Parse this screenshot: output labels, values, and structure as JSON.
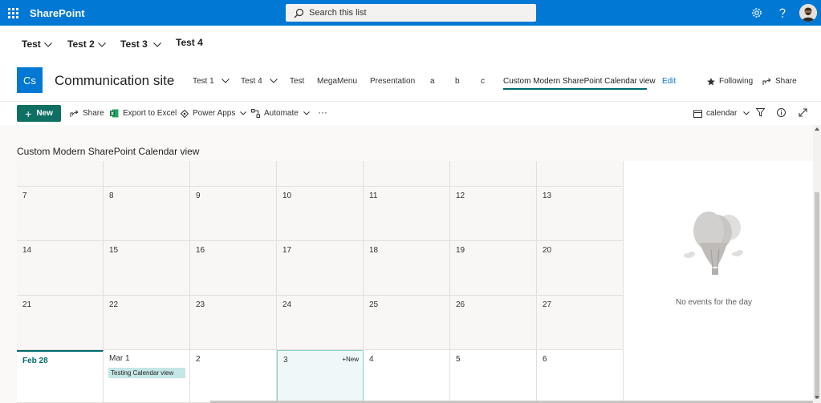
{
  "suitebar": {
    "brand": "SharePoint",
    "search_placeholder": "Search this list"
  },
  "hubnav": {
    "items": [
      {
        "label": "Test",
        "has_dropdown": true
      },
      {
        "label": "Test 2",
        "has_dropdown": true
      },
      {
        "label": "Test 3",
        "has_dropdown": true
      },
      {
        "label": "Test 4",
        "has_dropdown": false
      }
    ]
  },
  "site": {
    "logo_text": "Cs",
    "title": "Communication site",
    "nav": [
      {
        "label": "Test 1",
        "has_dropdown": true
      },
      {
        "label": "Test 4",
        "has_dropdown": true
      },
      {
        "label": "Test"
      },
      {
        "label": "MegaMenu"
      },
      {
        "label": "Presentation"
      },
      {
        "label": "a"
      },
      {
        "label": "b"
      },
      {
        "label": "c"
      },
      {
        "label": "Custom Modern SharePoint Calendar view",
        "active": true
      }
    ],
    "edit_label": "Edit",
    "following_label": "Following",
    "share_label": "Share"
  },
  "commandbar": {
    "new_label": "New",
    "share_label": "Share",
    "export_label": "Export to Excel",
    "powerapps_label": "Power Apps",
    "automate_label": "Automate",
    "more_label": "···",
    "view_label": "calendar"
  },
  "main": {
    "view_title": "Custom Modern SharePoint Calendar view",
    "calendar": {
      "weeks": [
        [
          "",
          "",
          "",
          "",
          "",
          "",
          ""
        ],
        [
          "7",
          "8",
          "9",
          "10",
          "11",
          "12",
          "13"
        ],
        [
          "14",
          "15",
          "16",
          "17",
          "18",
          "19",
          "20"
        ],
        [
          "21",
          "22",
          "23",
          "24",
          "25",
          "26",
          "27"
        ],
        [
          "Feb 28",
          "Mar 1",
          "2",
          "3",
          "4",
          "5",
          "6"
        ]
      ],
      "event": {
        "title": "Testing Calendar view",
        "day": "Mar 1"
      },
      "selected_new_label": "New"
    },
    "side_panel": {
      "no_events_text": "No events for the day"
    }
  }
}
